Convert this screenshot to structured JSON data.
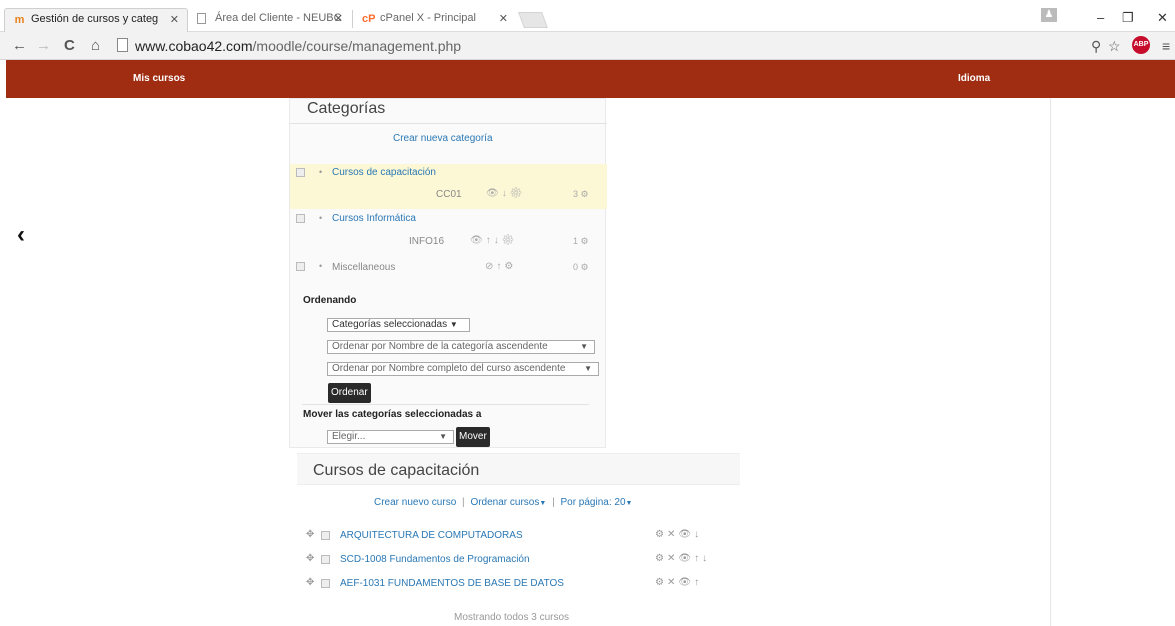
{
  "browser": {
    "tabs": [
      {
        "title": "Gestión de cursos y categ",
        "favicon": "moodle-logo",
        "active": true
      },
      {
        "title": "Área del Cliente - NEUBC",
        "favicon": "page-icon",
        "active": false
      },
      {
        "title": "cPanel X - Principal",
        "favicon": "cpanel-icon",
        "active": false
      }
    ],
    "url": {
      "host": "www.cobao42.com",
      "path": "/moodle/course/management.php"
    }
  },
  "navbar": {
    "my_courses": "Mis cursos",
    "language": "Idioma"
  },
  "categories": {
    "title": "Categorías",
    "create_link": "Crear nueva categoría",
    "items": [
      {
        "name": "Cursos de capacitación",
        "idnumber": "CC01",
        "count": "3",
        "highlighted": true,
        "visible": true
      },
      {
        "name": "Cursos Informática",
        "idnumber": "INFO16",
        "count": "1",
        "highlighted": false,
        "visible": true
      },
      {
        "name": "Miscellaneous",
        "idnumber": "",
        "count": "0",
        "highlighted": false,
        "visible": false
      }
    ],
    "sorting": {
      "title": "Ordenando",
      "scope_select": "Categorías seleccionadas",
      "sort_categories_select": "Ordenar por Nombre de la categoría ascendente",
      "sort_courses_select": "Ordenar por Nombre completo del curso ascendente",
      "sort_button": "Ordenar"
    },
    "move": {
      "title": "Mover las categorías seleccionadas a",
      "choose_select": "Elegir...",
      "move_button": "Mover"
    }
  },
  "courses": {
    "title": "Cursos de capacitación",
    "create_link": "Crear nuevo curso",
    "sort_link": "Ordenar cursos",
    "per_page_link": "Por página: 20",
    "separator": "|",
    "items": [
      {
        "name": "ARQUITECTURA DE COMPUTADORAS"
      },
      {
        "name": "SCD-1008 Fundamentos de Programación"
      },
      {
        "name": "AEF-1031 FUNDAMENTOS DE BASE DE DATOS"
      }
    ],
    "footer": "Mostrando todos 3 cursos"
  },
  "colors": {
    "navbar": "#a02c11",
    "link": "#2a78b5",
    "highlight_row": "#fcf8d5"
  }
}
